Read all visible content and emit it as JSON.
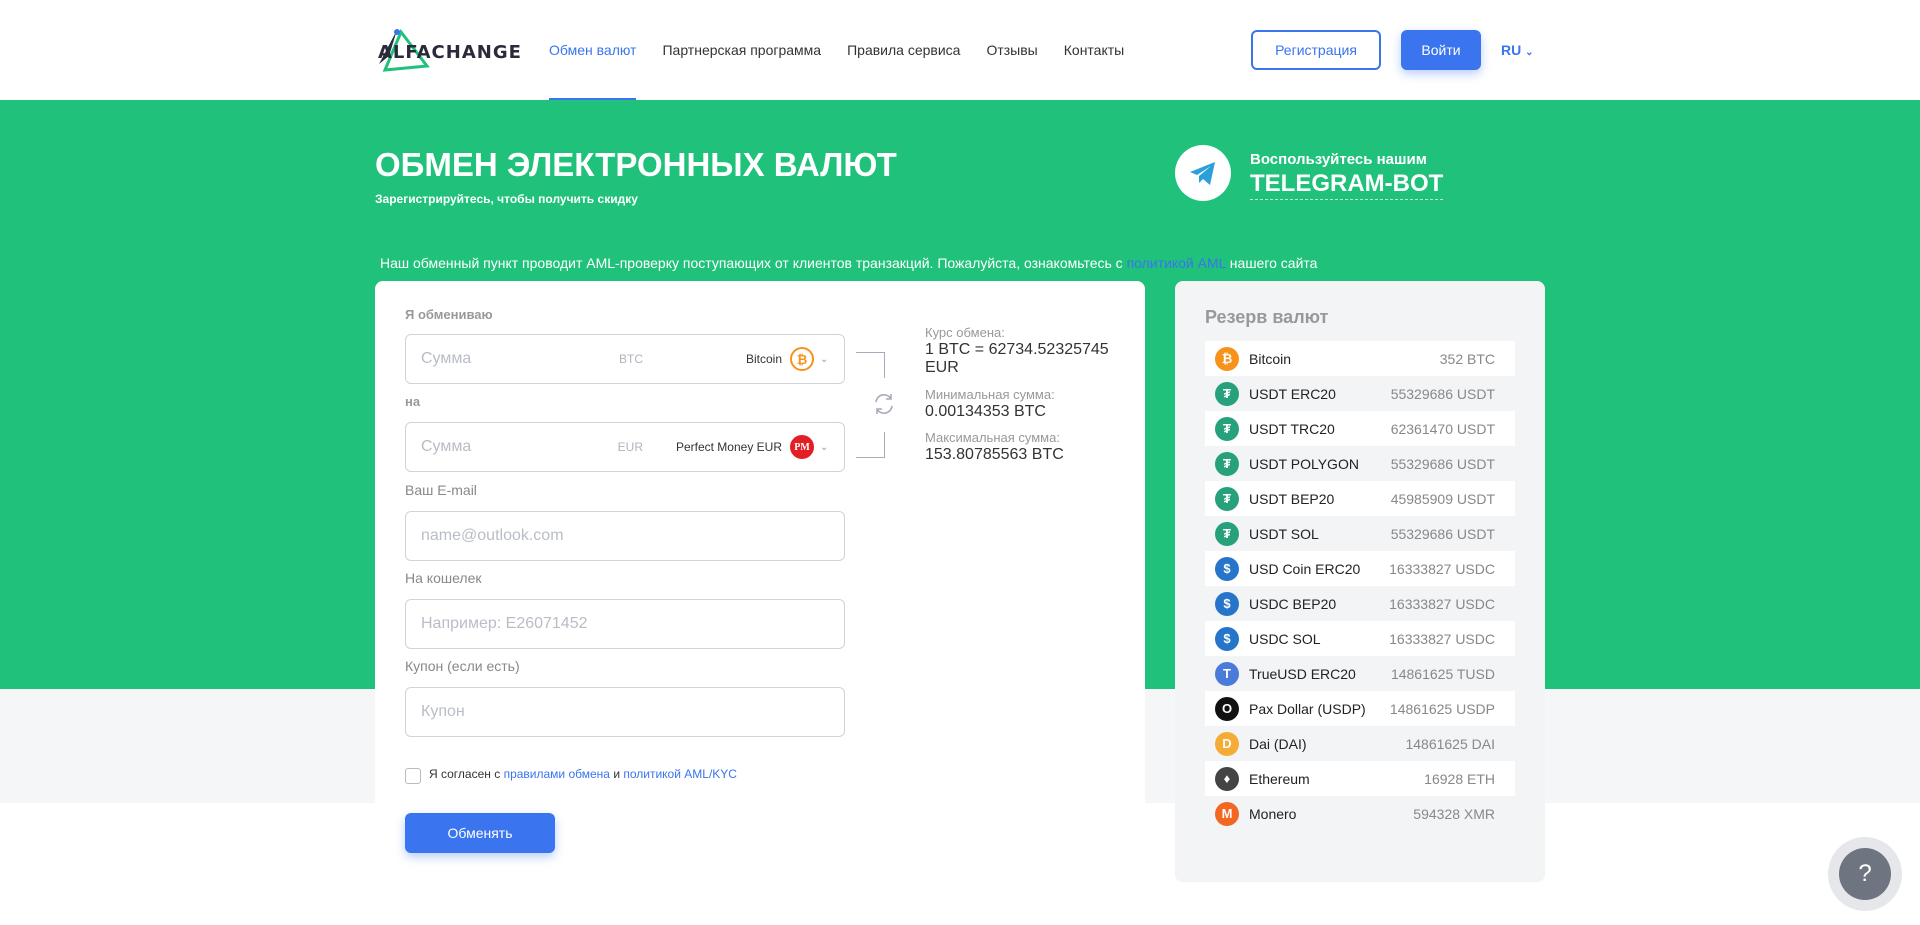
{
  "header": {
    "logo_text": "ALFACHANGE",
    "nav": [
      "Обмен валют",
      "Партнерская программа",
      "Правила сервиса",
      "Отзывы",
      "Контакты"
    ],
    "register_label": "Регистрация",
    "login_label": "Войти",
    "lang": "RU"
  },
  "hero": {
    "title": "ОБМЕН ЭЛЕКТРОННЫХ ВАЛЮТ",
    "subtitle": "Зарегистрируйтесь, чтобы получить скидку",
    "tg_line1": "Воспользуйтесь нашим",
    "tg_line2": "TELEGRAM-BOT",
    "aml_before": "Наш обменный пункт проводит AML-проверку поступающих от клиентов транзакций. Пожалуйста, ознакомьтесь с ",
    "aml_link": "политикой AML",
    "aml_after": " нашего сайта"
  },
  "form": {
    "give_label": "Я обмениваю",
    "give_placeholder": "Сумма",
    "give_currency": "BTC",
    "give_select": "Bitcoin",
    "get_label": "на",
    "get_placeholder": "Сумма",
    "get_currency": "EUR",
    "get_select": "Perfect Money EUR",
    "email_label": "Ваш E-mail",
    "email_placeholder": "name@outlook.com",
    "wallet_label": "На кошелек",
    "wallet_placeholder": "Например: E26071452",
    "coupon_label": "Купон (если есть)",
    "coupon_placeholder": "Купон",
    "agree_text": "Я согласен с ",
    "agree_link1": "правилами обмена",
    "agree_and": " и ",
    "agree_link2": "политикой AML/KYC",
    "submit_label": "Обменять"
  },
  "rate": {
    "rate_label": "Курс обмена:",
    "rate_value": "1 BTC = 62734.52325745 EUR",
    "min_label": "Минимальная сумма:",
    "min_value": "0.00134353 BTC",
    "max_label": "Максимальная сумма:",
    "max_value": "153.80785563 BTC"
  },
  "reserve": {
    "title": "Резерв валют",
    "items": [
      {
        "name": "Bitcoin",
        "amount": "352 BTC",
        "icon": "bitcoin-icon",
        "color": "#f7931a",
        "glyph": "₿"
      },
      {
        "name": "USDT ERC20",
        "amount": "55329686 USDT",
        "icon": "tether-icon",
        "color": "#26a17b",
        "glyph": "₮"
      },
      {
        "name": "USDT TRC20",
        "amount": "62361470 USDT",
        "icon": "tether-icon",
        "color": "#26a17b",
        "glyph": "₮"
      },
      {
        "name": "USDT POLYGON",
        "amount": "55329686 USDT",
        "icon": "tether-icon",
        "color": "#26a17b",
        "glyph": "₮"
      },
      {
        "name": "USDT BEP20",
        "amount": "45985909 USDT",
        "icon": "tether-icon",
        "color": "#26a17b",
        "glyph": "₮"
      },
      {
        "name": "USDT SOL",
        "amount": "55329686 USDT",
        "icon": "tether-icon",
        "color": "#26a17b",
        "glyph": "₮"
      },
      {
        "name": "USD Coin ERC20",
        "amount": "16333827 USDC",
        "icon": "usdc-icon",
        "color": "#2775ca",
        "glyph": "$"
      },
      {
        "name": "USDC BEP20",
        "amount": "16333827 USDC",
        "icon": "usdc-icon",
        "color": "#2775ca",
        "glyph": "$"
      },
      {
        "name": "USDC SOL",
        "amount": "16333827 USDC",
        "icon": "usdc-icon",
        "color": "#2775ca",
        "glyph": "$"
      },
      {
        "name": "TrueUSD ERC20",
        "amount": "14861625 TUSD",
        "icon": "trueusd-icon",
        "color": "#4a7bd9",
        "glyph": "T"
      },
      {
        "name": "Pax Dollar (USDP)",
        "amount": "14861625 USDP",
        "icon": "paxdollar-icon",
        "color": "#111111",
        "glyph": "O"
      },
      {
        "name": "Dai (DAI)",
        "amount": "14861625 DAI",
        "icon": "dai-icon",
        "color": "#f5ac37",
        "glyph": "D"
      },
      {
        "name": "Ethereum",
        "amount": "16928 ETH",
        "icon": "ethereum-icon",
        "color": "#444444",
        "glyph": "♦"
      },
      {
        "name": "Monero",
        "amount": "594328 XMR",
        "icon": "monero-icon",
        "color": "#f26822",
        "glyph": "M"
      }
    ]
  },
  "help_label": "?",
  "colors": {
    "accent": "#3a74ee",
    "hero_bg": "#20c27b",
    "pm_red": "#e31e24"
  }
}
